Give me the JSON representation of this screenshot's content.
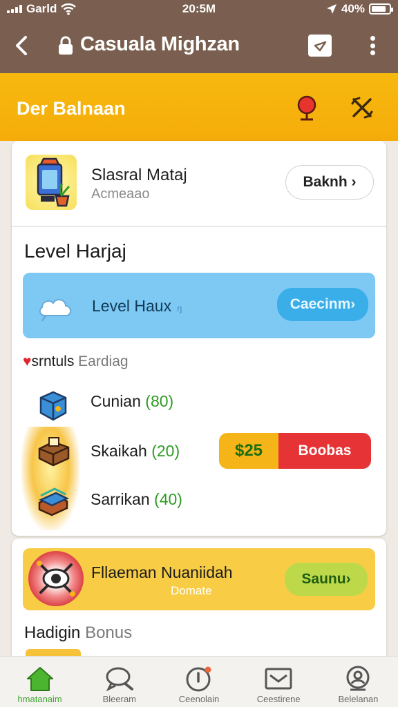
{
  "status_bar": {
    "carrier": "Garld",
    "time": "20:5M",
    "battery": "40%"
  },
  "app_bar": {
    "title": "Casuala Mighzan"
  },
  "header": {
    "title": "Der Balnaan"
  },
  "profile": {
    "name": "Slasral Mataj",
    "subtitle": "Acmeaao",
    "button": "Baknh ›"
  },
  "level": {
    "heading": "Level Harjaj",
    "banner_text": "Level Haux",
    "banner_small": "ŋ",
    "banner_button": "Caecinm›"
  },
  "section": {
    "heart": "♥",
    "title_a": "srntuls",
    "title_b": "Eardiag"
  },
  "items": [
    {
      "label": "Cunian",
      "count": "(80)"
    },
    {
      "label": "Skaikah",
      "count": "(20)"
    },
    {
      "label": "Sarrikan",
      "count": "(40)"
    }
  ],
  "offer": {
    "price": "$25",
    "button": "Boobas"
  },
  "promo": {
    "title": "Fllaeman Nuaniidah",
    "subtitle": "Domate",
    "button": "Saunu›"
  },
  "bonus": {
    "a": "Hadigin",
    "b": "Bonus"
  },
  "bottom_nav": [
    {
      "label": "hmatanaim",
      "icon": "home-icon",
      "active": true
    },
    {
      "label": "Bleeram",
      "icon": "chat-search-icon",
      "active": false
    },
    {
      "label": "Ceenolain",
      "icon": "info-alert-icon",
      "active": false
    },
    {
      "label": "Ceestirene",
      "icon": "mail-icon",
      "active": false
    },
    {
      "label": "Belelanan",
      "icon": "profile-icon",
      "active": false
    }
  ],
  "colors": {
    "brown": "#7a5f50",
    "orange": "#f7b90e",
    "accent_green": "#3aa52b",
    "sky": "#7dc9f4",
    "red": "#e63436"
  }
}
